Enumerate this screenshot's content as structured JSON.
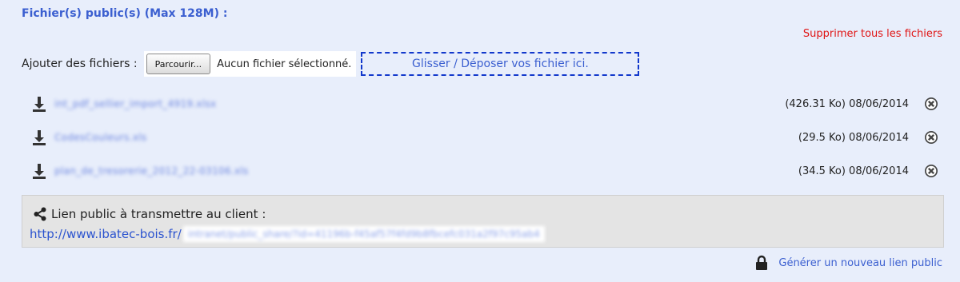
{
  "section": {
    "title": "Fichier(s) public(s) (Max 128M) :",
    "delete_all": "Supprimer tous les fichiers"
  },
  "upload": {
    "label": "Ajouter des fichiers :",
    "browse_button": "Parcourir...",
    "no_file": "Aucun fichier sélectionné.",
    "dropzone": "Glisser / Déposer vos fichier ici."
  },
  "files": [
    {
      "name": "int_pdf_sellier_import_4919.xlsx",
      "meta": "(426.31 Ko) 08/06/2014",
      "download_icon": "download-icon",
      "delete_icon": "delete-circle-icon"
    },
    {
      "name": "CodesCouleurs.xls",
      "meta": "(29.5 Ko) 08/06/2014",
      "download_icon": "download-icon",
      "delete_icon": "delete-circle-icon"
    },
    {
      "name": "plan_de_tresorerie_2012_22-03106.xls",
      "meta": "(34.5 Ko) 08/06/2014",
      "download_icon": "download-icon",
      "delete_icon": "delete-circle-icon"
    }
  ],
  "public_link": {
    "icon": "share-icon",
    "title": "Lien public à transmettre au client :",
    "url_prefix": "http://www.ibatec-bois.fr/",
    "url_token": "intranet/public_share/?id=41196b-f45af57f4fd9b8fbcefc031a2f97c95ab4"
  },
  "regenerate": {
    "icon": "lock-icon",
    "label": "Générer un nouveau lien public"
  },
  "colors": {
    "accent": "#3b5fd0",
    "danger": "#e01515",
    "background": "#e8eefb",
    "dropzone_border": "#1238cc"
  }
}
